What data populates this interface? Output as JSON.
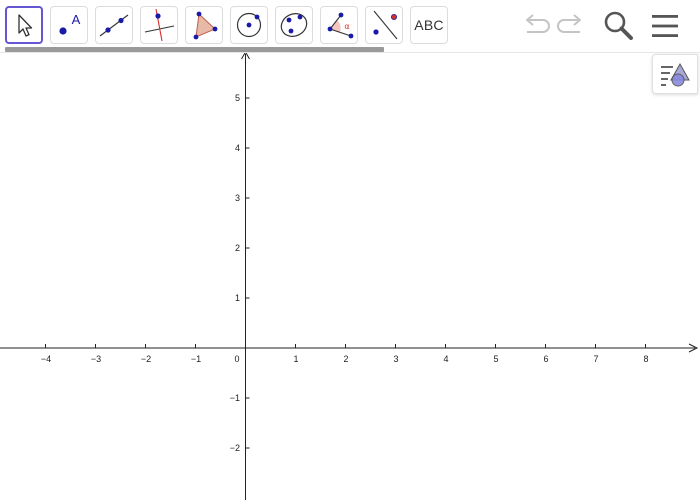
{
  "toolbar": {
    "tools": [
      {
        "name": "move-tool-button",
        "icon": "cursor-arrow-icon"
      },
      {
        "name": "point-tool-button",
        "icon": "point-icon",
        "label": "A"
      },
      {
        "name": "line-tool-button",
        "icon": "line-icon"
      },
      {
        "name": "perpendicular-line-tool-button",
        "icon": "perpendicular-line-icon"
      },
      {
        "name": "polygon-tool-button",
        "icon": "polygon-icon"
      },
      {
        "name": "circle-tool-button",
        "icon": "circle-center-point-icon"
      },
      {
        "name": "conic-tool-button",
        "icon": "ellipse-icon"
      },
      {
        "name": "angle-tool-button",
        "icon": "angle-icon",
        "label": "α"
      },
      {
        "name": "reflect-tool-button",
        "icon": "reflect-about-line-icon"
      },
      {
        "name": "text-tool-button",
        "icon": "text-icon",
        "label": "ABC"
      }
    ],
    "right": [
      "undo-icon",
      "redo-icon",
      "search-icon",
      "menu-icon"
    ]
  },
  "graphics": {
    "x_ticks": [
      "−4",
      "−3",
      "−2",
      "−1",
      "1",
      "2",
      "3",
      "4",
      "5",
      "6",
      "7",
      "8"
    ],
    "y_ticks": [
      "5",
      "4",
      "3",
      "2",
      "1",
      "−1",
      "−2"
    ],
    "origin_label": "0",
    "x_range": [
      -4.9,
      9.05
    ],
    "y_range": [
      -2.85,
      5.9
    ]
  },
  "colors": {
    "accent": "#6557d2",
    "point": "#1a1aa8",
    "polygon_fill": "#e9b9a8",
    "polygon_stroke": "#c06050",
    "angle_red": "#d9302a",
    "disabled": "#c4c4c4"
  }
}
